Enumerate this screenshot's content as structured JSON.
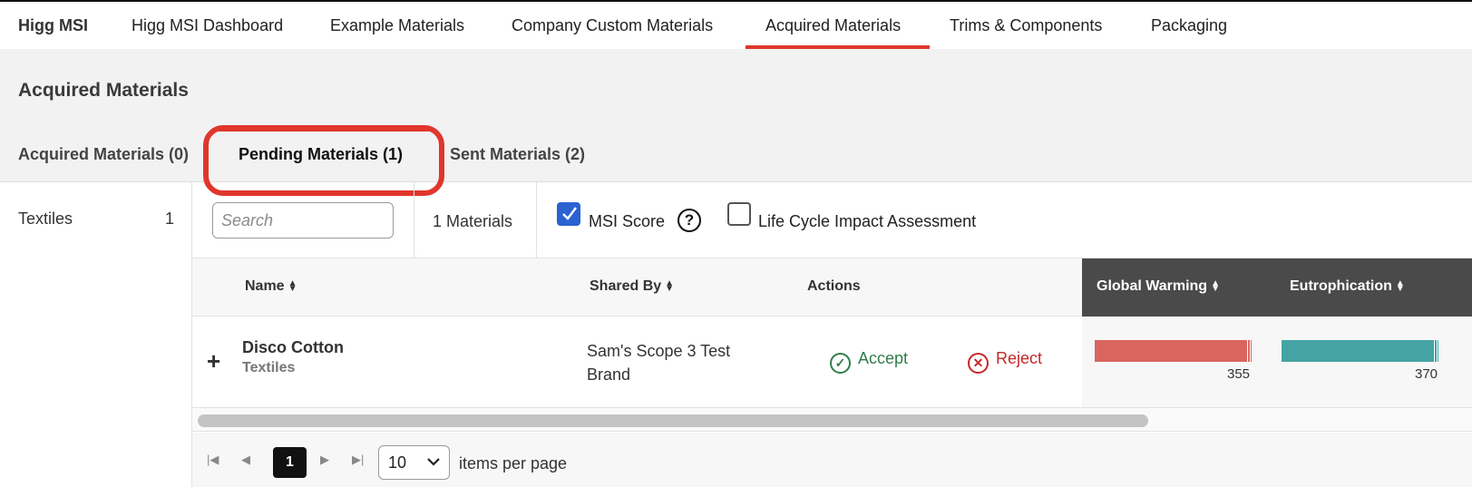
{
  "nav": {
    "brand": "Higg MSI",
    "items": [
      "Higg MSI Dashboard",
      "Example Materials",
      "Company Custom Materials",
      "Acquired Materials",
      "Trims & Components",
      "Packaging"
    ],
    "active": "Acquired Materials"
  },
  "header": {
    "title": "Acquired Materials",
    "tabs": [
      "Acquired Materials (0)",
      "Pending Materials (1)",
      "Sent Materials (2)"
    ],
    "active_tab": "Pending Materials (1)"
  },
  "sidebar": {
    "items": [
      {
        "label": "Textiles",
        "count": "1"
      }
    ]
  },
  "toolbar": {
    "search_placeholder": "Search",
    "materials_count": "1 Materials",
    "msi_score_label": "MSI Score",
    "msi_score_checked": true,
    "lca_label": "Life Cycle Impact Assessment",
    "lca_checked": false
  },
  "table": {
    "headers": {
      "name": "Name",
      "shared_by": "Shared By",
      "actions": "Actions",
      "global_warming": "Global Warming",
      "eutrophication": "Eutrophication"
    },
    "rows": [
      {
        "name": "Disco Cotton",
        "category": "Textiles",
        "shared_by": "Sam's Scope 3 Test Brand",
        "accept_label": "Accept",
        "reject_label": "Reject",
        "global_warming": "355",
        "eutrophication": "370"
      }
    ]
  },
  "colors": {
    "accent_red": "#e0362c",
    "global_warming_bar": "#d9655f",
    "eutrophication_bar": "#45a3a3",
    "accept": "#2f7d4b",
    "reject": "#c62828"
  },
  "pager": {
    "current_page": "1",
    "page_size": "10",
    "items_per_page_label": "items per page"
  }
}
